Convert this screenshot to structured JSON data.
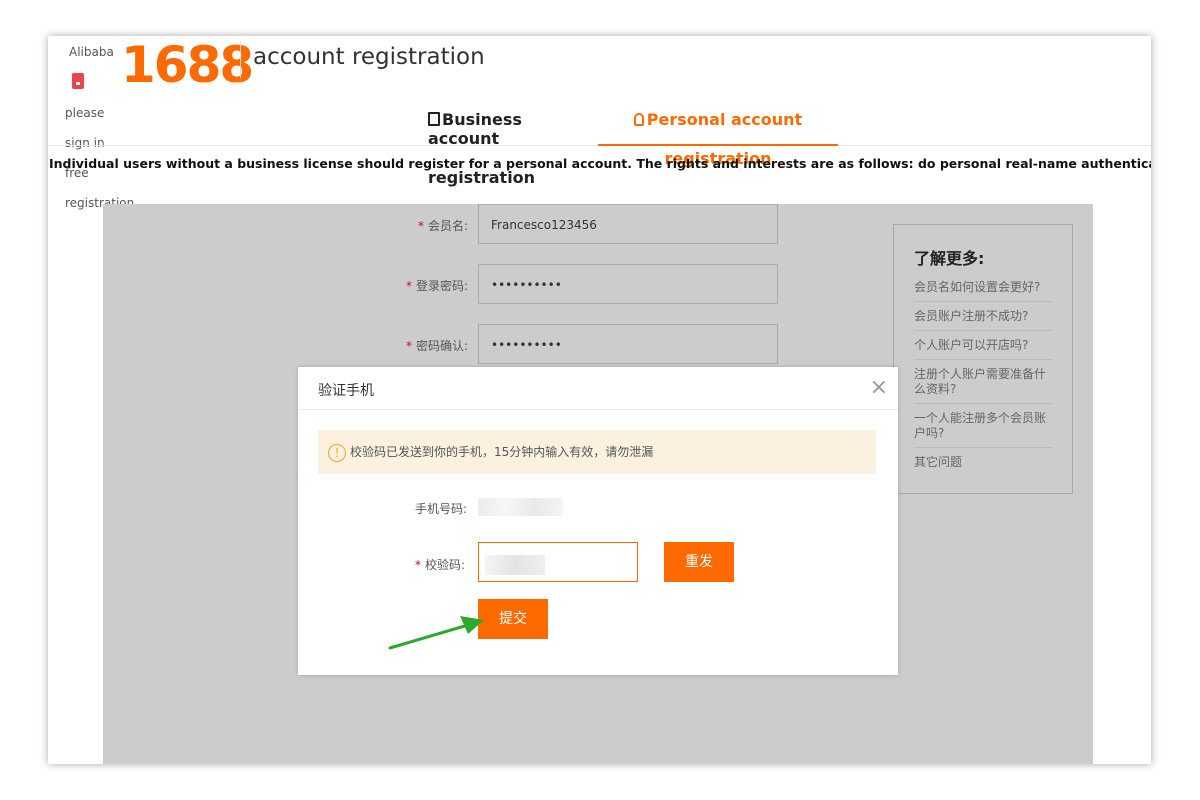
{
  "header": {
    "alibaba": "Alibaba",
    "logo": "1688",
    "title": "account registration",
    "left_links": [
      "please",
      "sign in",
      "free",
      "registration"
    ]
  },
  "tabs": {
    "business": "Business account registration",
    "business_l1": "Business account",
    "business_l2": "registration",
    "personal_l1": "Personal account",
    "personal_l2": "registration"
  },
  "intro": "Individual users without a business license should register for a personal account. The rights and interests are as follows: do personal real-name authentication; purchase as a buyer;",
  "form": {
    "member_label": "会员名:",
    "member_value": "Francesco123456",
    "password_label": "登录密码:",
    "password_value": "••••••••••",
    "confirm_label": "密码确认:",
    "confirm_value": "••••••••••"
  },
  "help": {
    "title": "了解更多:",
    "items": [
      "会员名如何设置会更好?",
      "会员账户注册不成功?",
      "个人账户可以开店吗?",
      "注册个人账户需要准备什么资料?",
      "一个人能注册多个会员账户吗?",
      "其它问题"
    ]
  },
  "modal": {
    "title": "验证手机",
    "close": "×",
    "notice_icon": "!",
    "notice": "校验码已发送到你的手机，15分钟内输入有效，请勿泄漏",
    "phone_label": "手机号码:",
    "code_label": "校验码:",
    "resend": "重发",
    "submit": "提交"
  },
  "colors": {
    "accent": "#ff6a00",
    "required": "#d9001b",
    "arrow": "#2ea82e"
  }
}
